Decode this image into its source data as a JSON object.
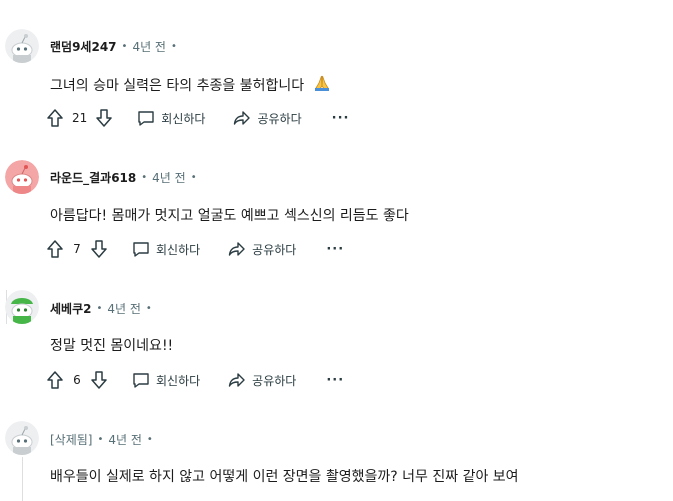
{
  "comments": [
    {
      "author": "랜덤9세247",
      "time": "4년 전",
      "text": "그녀의 승마 실력은 타의 추종을 불허합니다",
      "emoji": "praying-hands",
      "score": "21",
      "reply_label": "회신하다",
      "share_label": "공유하다",
      "more": "···",
      "avatar_color": "#e8ecee"
    },
    {
      "author": "라운드_결과618",
      "time": "4년 전",
      "text": "아름답다! 몸매가 멋지고 얼굴도 예쁘고 섹스신의 리듬도 좋다",
      "score": "7",
      "reply_label": "회신하다",
      "share_label": "공유하다",
      "more": "···",
      "avatar_color": "#f4a6a6"
    },
    {
      "author": "세베쿠2",
      "time": "4년 전",
      "text": "정말 멋진 몸이네요!!",
      "score": "6",
      "reply_label": "회신하다",
      "share_label": "공유하다",
      "more": "···",
      "avatar_color": "#e8ecee"
    },
    {
      "author": "[삭제됨]",
      "time": "4년 전",
      "text": "배우들이 실제로 하지 않고 어떻게 이런 장면을 촬영했을까? 너무 진짜 같아 보여",
      "avatar_color": "#e8ecee"
    }
  ],
  "separator": "•"
}
